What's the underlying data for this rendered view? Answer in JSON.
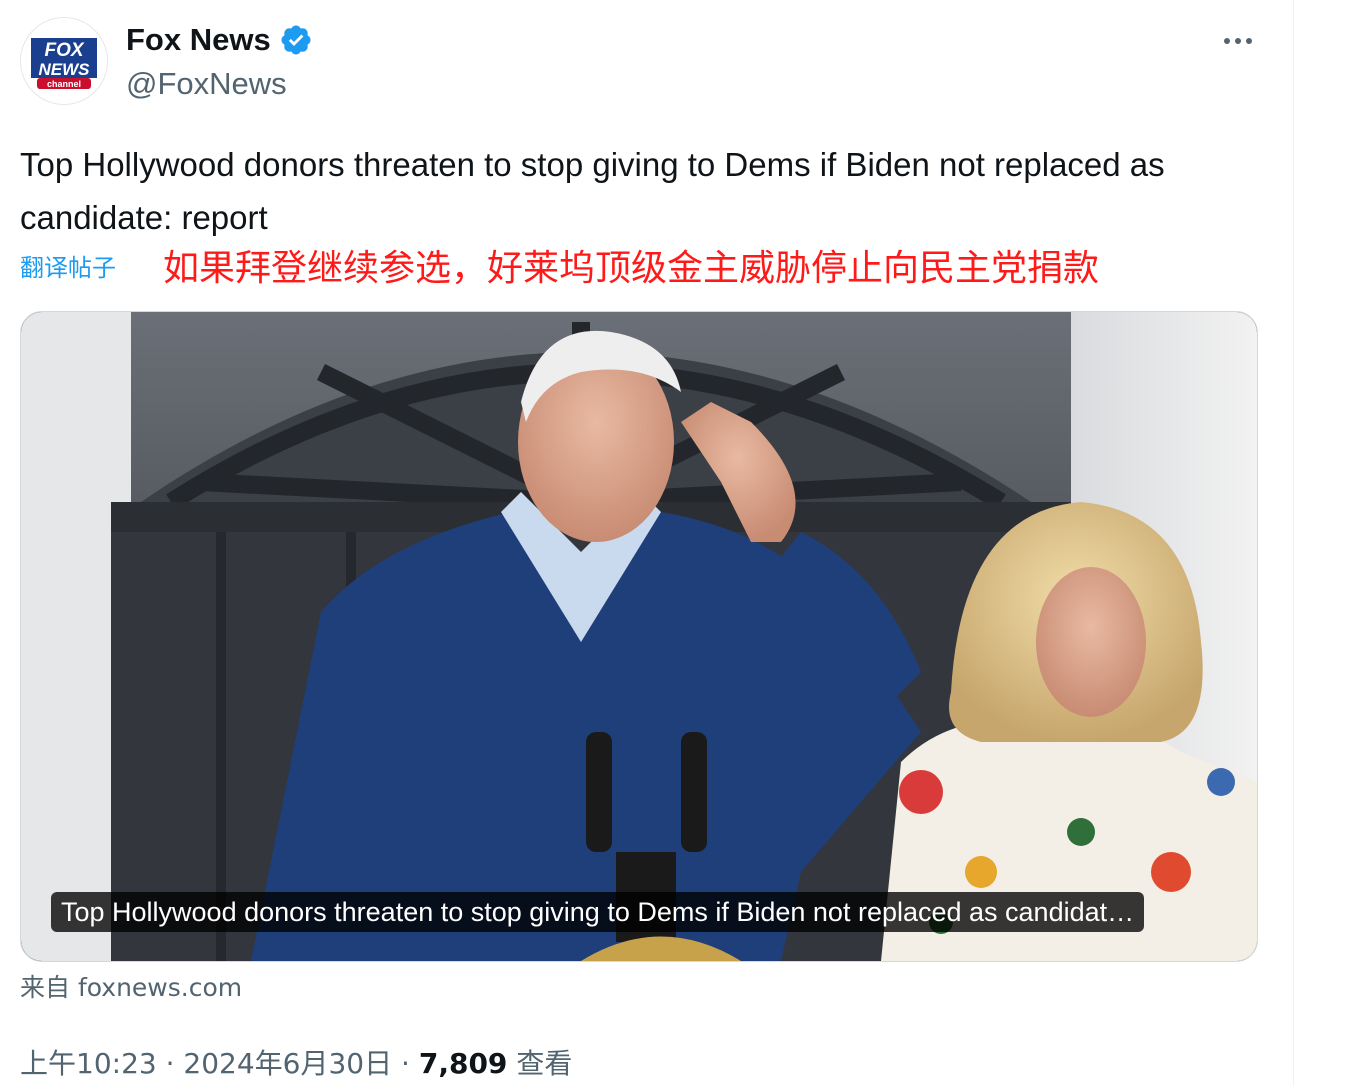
{
  "author": {
    "display_name": "Fox News",
    "handle": "@FoxNews",
    "avatar_logo_text": [
      "FOX",
      "NEWS",
      "channel"
    ]
  },
  "tweet": {
    "text": "Top Hollywood donors threaten to stop giving to Dems if Biden not replaced as candidate: report",
    "translate_link": "翻译帖子",
    "translation_overlay": "如果拜登继续参选，好莱坞顶级金主威胁停止向民主党捐款"
  },
  "link_card": {
    "caption": "Top Hollywood donors threaten to stop giving to Dems if Biden not replaced as candidat…",
    "source": "来自 foxnews.com"
  },
  "metadata": {
    "time": "上午10:23",
    "date": "2024年6月30日",
    "separator": "·",
    "views_count": "7,809",
    "views_label": "查看"
  },
  "colors": {
    "link": "#1d9bf0",
    "verified": "#1d9bf0",
    "translation": "#ff1a1a",
    "secondary_text": "#536471"
  },
  "icons": [
    "verified-badge-icon",
    "more-options-icon"
  ]
}
